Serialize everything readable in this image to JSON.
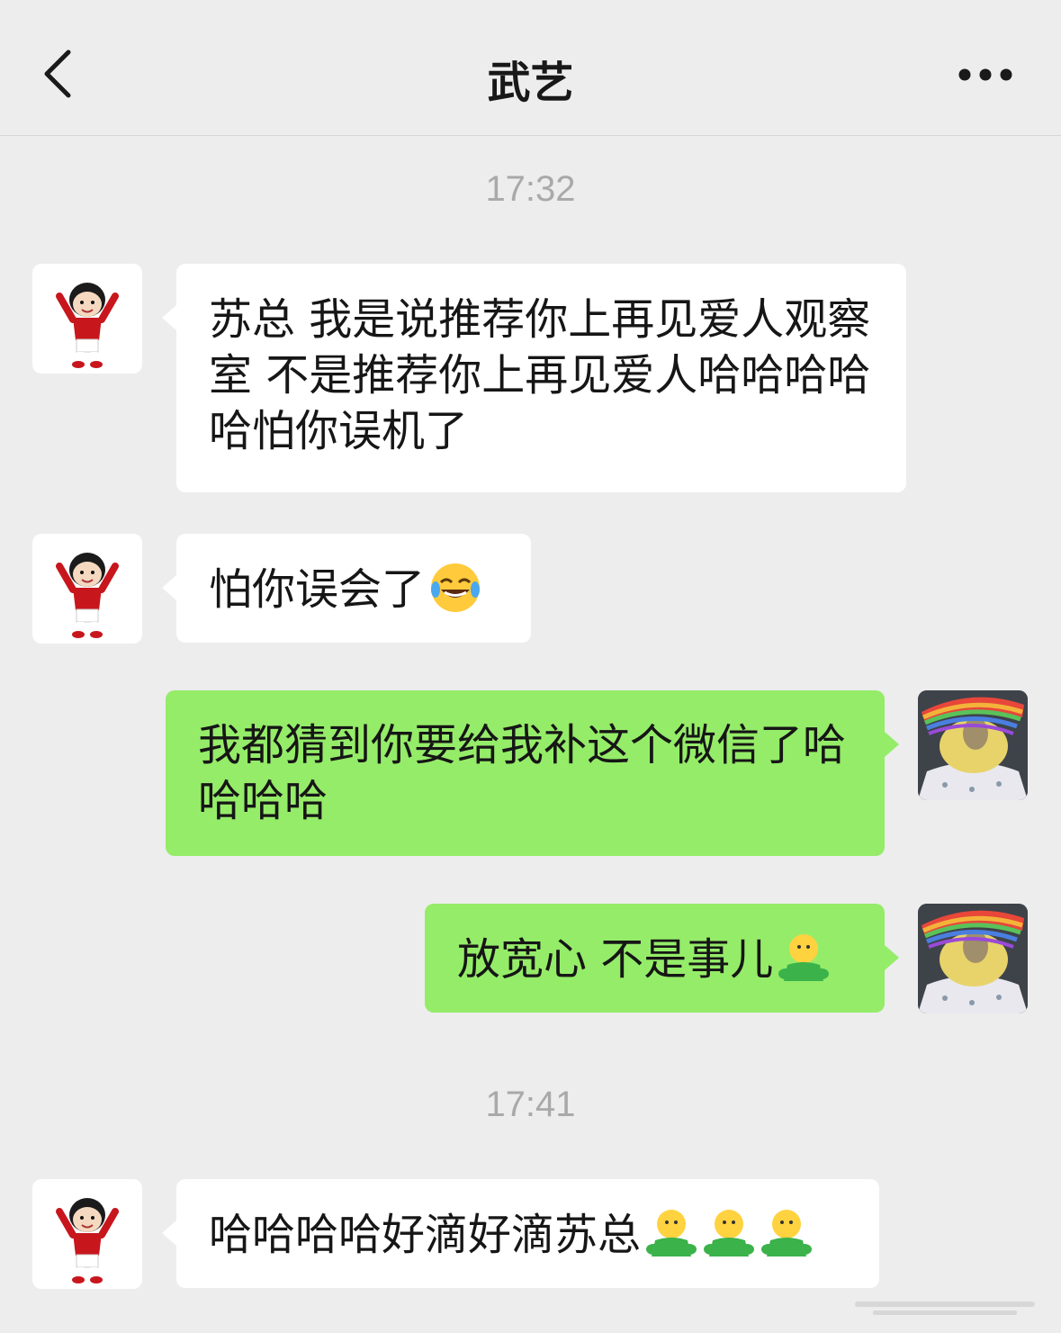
{
  "header": {
    "title": "武艺",
    "back_icon": "chevron-left-icon",
    "more_icon": "more-dots-icon"
  },
  "colors": {
    "background": "#ededed",
    "incoming_bubble": "#ffffff",
    "outgoing_bubble": "#95ec69",
    "timestamp": "#a9a9a9"
  },
  "timestamps": [
    "17:32",
    "17:41"
  ],
  "messages": [
    {
      "direction": "incoming",
      "text": "苏总 我是说推荐你上再见爱人观察室 不是推荐你上再见爱人哈哈哈哈哈怕你误机了",
      "emojis": []
    },
    {
      "direction": "incoming",
      "text": "怕你误会了",
      "emojis": [
        "laughing-tears-emoji"
      ]
    },
    {
      "direction": "outgoing",
      "text": "我都猜到你要给我补这个微信了哈哈哈哈",
      "emojis": []
    },
    {
      "direction": "outgoing",
      "text": "放宽心 不是事儿",
      "emojis": [
        "hug-emoji"
      ]
    },
    {
      "direction": "incoming",
      "text": "哈哈哈哈好滴好滴苏总",
      "emojis": [
        "hug-emoji",
        "hug-emoji",
        "hug-emoji"
      ]
    }
  ]
}
